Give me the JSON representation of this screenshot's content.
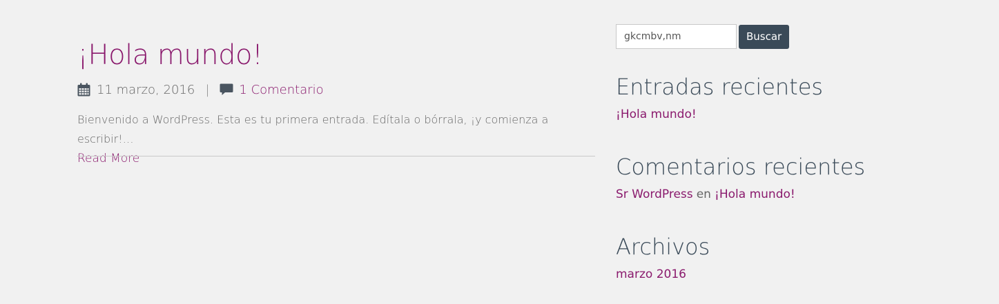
{
  "post": {
    "title": "¡Hola mundo!",
    "date": "11 marzo, 2016",
    "separator": "|",
    "comments_label": "1 Comentario",
    "excerpt": "Bienvenido a WordPress. Esta es tu primera entrada. Edítala o bórrala, ¡y comienza a escribir!…",
    "read_more": "Read More",
    "icons": {
      "date": "calendar-icon",
      "comments": "comment-icon"
    }
  },
  "sidebar": {
    "search": {
      "value": "gkcmbv,nm",
      "button_label": "Buscar"
    },
    "recent_posts": {
      "title": "Entradas recientes",
      "items": [
        "¡Hola mundo!"
      ]
    },
    "recent_comments": {
      "title": "Comentarios recientes",
      "author": "Sr WordPress",
      "connector": "en",
      "post": "¡Hola mundo!"
    },
    "archives": {
      "title": "Archivos",
      "items": [
        "marzo 2016"
      ]
    }
  },
  "colors": {
    "background": "#f1f1f1",
    "link": "#8a1a6d",
    "heading": "#3a4a58",
    "button": "#3a4a58"
  }
}
